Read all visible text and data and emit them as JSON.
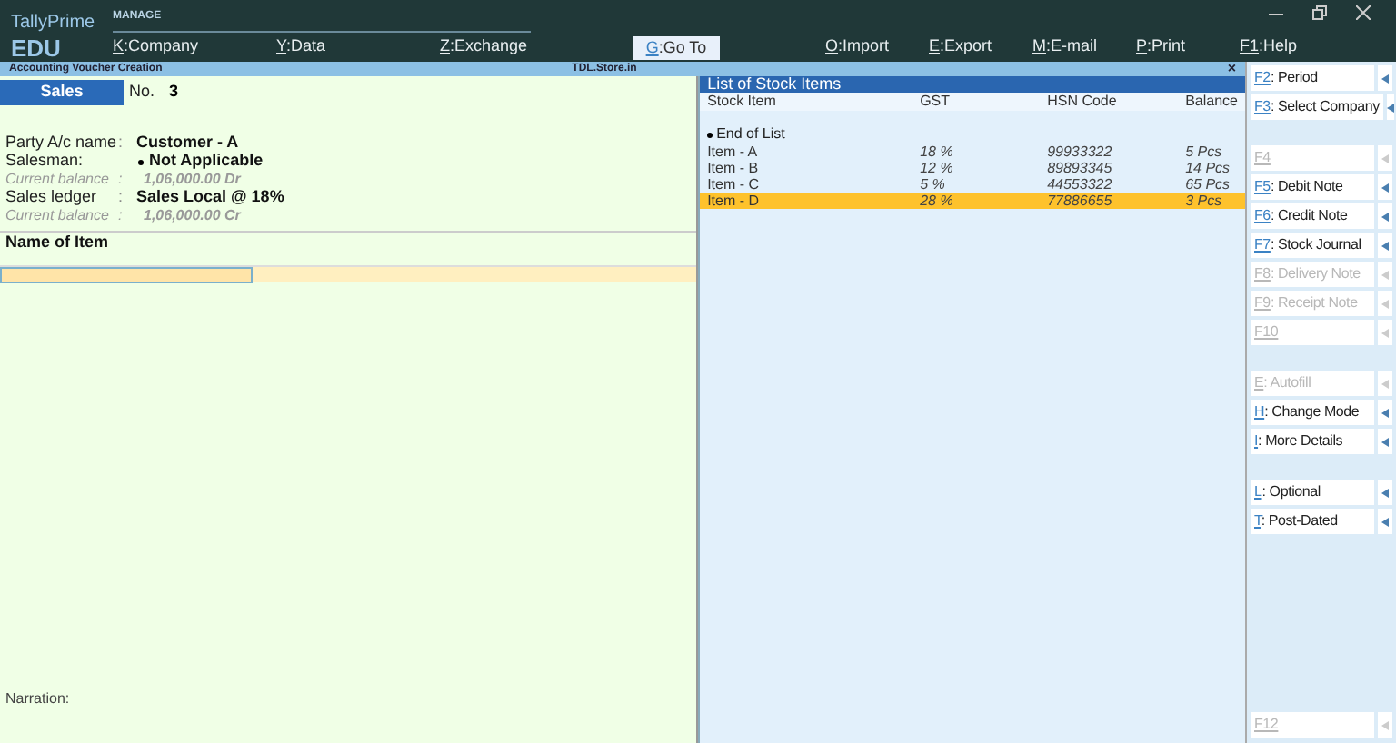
{
  "brand": {
    "name": "TallyPrime",
    "edition": "EDU"
  },
  "menu": {
    "section": "MANAGE",
    "items": [
      {
        "key": "K",
        "label": ":Company"
      },
      {
        "key": "Y",
        "label": ":Data"
      },
      {
        "key": "Z",
        "label": ":Exchange"
      }
    ],
    "goto": {
      "key": "G",
      "label": ":Go To"
    },
    "actions": [
      {
        "key": "O",
        "label": ":Import"
      },
      {
        "key": "E",
        "label": ":Export"
      },
      {
        "key": "M",
        "label": ":E-mail"
      },
      {
        "key": "P",
        "label": ":Print"
      },
      {
        "key": "F1",
        "label": ":Help"
      }
    ]
  },
  "subheader": {
    "title": "Accounting Voucher Creation",
    "right": "TDL.Store.in",
    "close": "×"
  },
  "voucher": {
    "type": "Sales",
    "number_label": "No.",
    "number": "3",
    "fields": [
      {
        "kind": "field",
        "label": "Party A/c name",
        "sep": ":",
        "value": "Customer - A"
      },
      {
        "kind": "bullet",
        "label": "Salesman:",
        "value": "Not Applicable"
      },
      {
        "kind": "balance",
        "label": "Current balance",
        "sep": ":",
        "value": "1,06,000.00 Dr"
      },
      {
        "kind": "field",
        "label": "Sales ledger",
        "sep": ":",
        "value": "Sales Local @ 18%"
      },
      {
        "kind": "balance",
        "label": "Current balance",
        "sep": ":",
        "value": "1,06,000.00 Cr"
      }
    ],
    "items_header": "Name of Item",
    "narration_label": "Narration:"
  },
  "stock_list": {
    "title": "List of Stock Items",
    "columns": [
      "Stock Item",
      "GST",
      "HSN Code",
      "Balance"
    ],
    "end_of_list": "End of List",
    "rows": [
      {
        "cells": [
          "Item - A",
          "18 %",
          "99933322",
          "5 Pcs"
        ],
        "selected": false
      },
      {
        "cells": [
          "Item - B",
          "12 %",
          "89893345",
          "14 Pcs"
        ],
        "selected": false
      },
      {
        "cells": [
          "Item - C",
          "5 %",
          "44553322",
          "65 Pcs"
        ],
        "selected": false
      },
      {
        "cells": [
          "Item - D",
          "28 %",
          "77886655",
          "3 Pcs"
        ],
        "selected": true
      }
    ]
  },
  "sidebar": {
    "groups": [
      [
        {
          "key": "F2",
          "label": ": Period",
          "disabled": false
        },
        {
          "key": "F3",
          "label": ": Select Company",
          "disabled": false
        }
      ],
      [
        {
          "key": "F4",
          "disabled": true
        },
        {
          "key": "F5",
          "label": ": Debit Note",
          "disabled": false
        },
        {
          "key": "F6",
          "label": ": Credit Note",
          "disabled": false
        },
        {
          "key": "F7",
          "label": ": Stock Journal",
          "disabled": false
        },
        {
          "key": "F8",
          "label": ": Delivery Note",
          "disabled": true
        },
        {
          "key": "F9",
          "label": ": Receipt Note",
          "disabled": true
        },
        {
          "key": "F10",
          "disabled": true
        }
      ],
      [
        {
          "key": "E",
          "label": ": Autofill",
          "disabled": true
        },
        {
          "key": "H",
          "label": ": Change Mode",
          "disabled": false
        },
        {
          "key": "I",
          "label": ": More Details",
          "disabled": false
        }
      ],
      [
        {
          "key": "L",
          "label": ": Optional",
          "disabled": false
        },
        {
          "key": "T",
          "label": ": Post-Dated",
          "disabled": false
        }
      ]
    ],
    "bottom": [
      {
        "key": "F12",
        "disabled": true
      }
    ]
  }
}
